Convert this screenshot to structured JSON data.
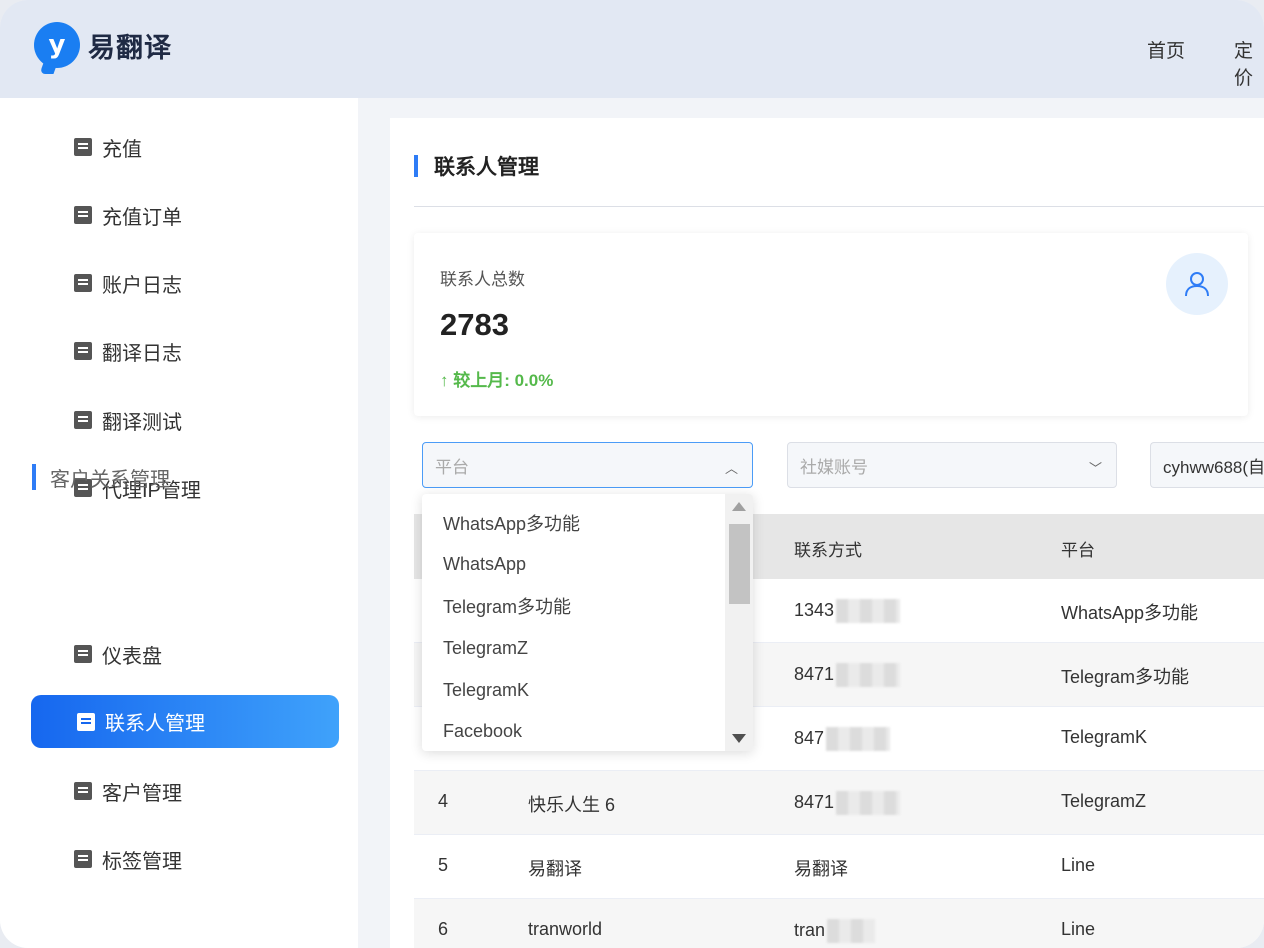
{
  "app": {
    "name": "易翻译"
  },
  "topnav": [
    "首页",
    "定价"
  ],
  "sidebar": {
    "items": [
      {
        "label": "充值",
        "icon": "clipboard-icon"
      },
      {
        "label": "充值订单",
        "icon": "books-icon"
      },
      {
        "label": "账户日志",
        "icon": "translate-icon"
      },
      {
        "label": "翻译日志",
        "icon": "code-icon"
      },
      {
        "label": "翻译测试",
        "icon": "clipboard-icon"
      },
      {
        "label": "代理IP管理",
        "icon": "clipboard-icon"
      }
    ],
    "section": "客户关系管理",
    "section_items": [
      {
        "label": "仪表盘",
        "icon": "translate-icon"
      },
      {
        "label": "联系人管理",
        "icon": "code-icon",
        "active": true
      },
      {
        "label": "客户管理",
        "icon": "clipboard-icon"
      },
      {
        "label": "标签管理",
        "icon": "clipboard-icon"
      }
    ]
  },
  "page": {
    "title": "联系人管理"
  },
  "stat": {
    "label": "联系人总数",
    "value": "2783",
    "change": "↑ 较上月: 0.0%",
    "icon": "user-icon"
  },
  "filters": {
    "platform_placeholder": "平台",
    "account_placeholder": "社媒账号",
    "user_value": "cyhww688(自"
  },
  "dropdown": {
    "options": [
      "WhatsApp多功能",
      "WhatsApp",
      "Telegram多功能",
      "TelegramZ",
      "TelegramK",
      "Facebook"
    ]
  },
  "table": {
    "columns": [
      "联系方式",
      "平台"
    ],
    "rows": [
      {
        "no": "",
        "name": "",
        "contact": "1343",
        "platform": "WhatsApp多功能"
      },
      {
        "no": "",
        "name": "",
        "contact": "8471",
        "platform": "Telegram多功能"
      },
      {
        "no": "",
        "name": "",
        "contact": "847",
        "platform": "TelegramK"
      },
      {
        "no": "4",
        "name": "快乐人生 6",
        "contact": "8471",
        "platform": "TelegramZ"
      },
      {
        "no": "5",
        "name": "易翻译",
        "contact": "易翻译",
        "platform": "Line"
      },
      {
        "no": "6",
        "name": "tranworld",
        "contact": "tran",
        "platform": "Line"
      }
    ]
  },
  "colors": {
    "accent": "#2e7cf6",
    "active_start": "#1667ef",
    "active_end": "#3fa2fb",
    "positive": "#55b94b"
  }
}
